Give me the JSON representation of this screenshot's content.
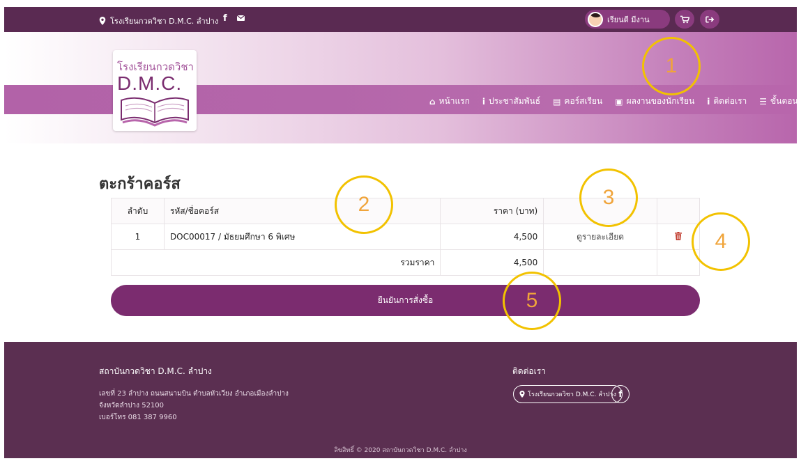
{
  "topbar": {
    "location": "โรงเรียนกวดวิชา D.M.C. ลำปาง",
    "facebook_glyph": "f",
    "user_name": "เรียนดี มีงาน"
  },
  "logo": {
    "line1": "โรงเรียนกวดวิชา",
    "line2": "D.M.C."
  },
  "nav": {
    "items": [
      {
        "icon": "home-icon",
        "glyph": "⌂",
        "label": "หน้าแรก"
      },
      {
        "icon": "info-icon",
        "glyph": "i",
        "label": "ประชาสัมพันธ์"
      },
      {
        "icon": "book-icon",
        "glyph": "▤",
        "label": "คอร์สเรียน"
      },
      {
        "icon": "id-card-icon",
        "glyph": "▣",
        "label": "ผลงานของนักเรียน"
      },
      {
        "icon": "info-icon",
        "glyph": "i",
        "label": "ติดต่อเรา"
      },
      {
        "icon": "list-icon",
        "glyph": "☰",
        "label": "ขั้นตอนการสมัครเรียน"
      }
    ]
  },
  "cart": {
    "title": "ตะกร้าคอร์ส",
    "headers": {
      "index": "ลำดับ",
      "course": "รหัส/ชื่อคอร์ส",
      "price": "ราคา (บาท)"
    },
    "rows": [
      {
        "index": "1",
        "course": "DOC00017 / มัธยมศึกษา 6 พิเศษ",
        "price": "4,500",
        "detail": "ดูรายละเอียด"
      }
    ],
    "total_label": "รวมราคา",
    "total_value": "4,500",
    "confirm_label": "ยืนยันการสั่งซื้อ"
  },
  "footer": {
    "heading": "สถาบันกวดวิชา D.M.C. ลำปาง",
    "address": [
      "เลขที่ 23 ลำปาง ถนนสนามบิน ตำบลหัวเวียง อำเภอเมืองลำปาง",
      "จังหวัดลำปาง 52100",
      "เบอร์โทร 081 387 9960"
    ],
    "contact_heading": "ติดต่อเรา",
    "location_button": "โรงเรียนกวดวิชา D.M.C. ลำปาง",
    "facebook_glyph": "f",
    "copyright": "ลิขสิทธิ์ © 2020 สถาบันกวดวิชา D.M.C. ลำปาง"
  },
  "annotations": [
    "1",
    "2",
    "3",
    "4",
    "5"
  ],
  "colors": {
    "topbar": "#5a2a52",
    "accent": "#7b2c6f",
    "footer": "#5b2f51",
    "annotation": "#f2c200"
  }
}
